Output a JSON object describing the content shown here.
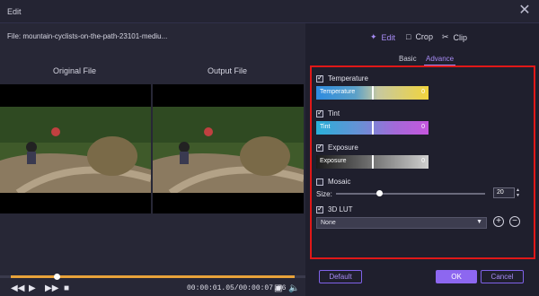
{
  "window": {
    "title": "Edit",
    "close_symbol": "✕"
  },
  "left": {
    "file_label": "File:  mountain-cyclists-on-the-path-23101-mediu...",
    "original_label": "Original File",
    "output_label": "Output File",
    "playback": {
      "progress_fraction": 0.15,
      "time": "00:00:01.05/00:00:07.06"
    }
  },
  "top_tabs": {
    "edit": "Edit",
    "crop": "Crop",
    "clip": "Clip"
  },
  "sub_tabs": {
    "basic": "Basic",
    "advance": "Advance"
  },
  "adjustments": {
    "temperature": {
      "label": "Temperature",
      "slider_label": "Temperature",
      "value": "0",
      "checked": true
    },
    "tint": {
      "label": "Tint",
      "slider_label": "Tint",
      "value": "0",
      "checked": true
    },
    "exposure": {
      "label": "Exposure",
      "slider_label": "Exposure",
      "value": "0",
      "checked": true
    },
    "mosaic": {
      "label": "Mosaic",
      "checked": false,
      "size_label": "Size:",
      "size_value": "20"
    },
    "lut": {
      "label": "3D LUT",
      "checked": true,
      "selected": "None"
    }
  },
  "buttons": {
    "default": "Default",
    "ok": "OK",
    "cancel": "Cancel"
  },
  "colors": {
    "accent": "#8d67f0",
    "highlight_border": "#e01818"
  }
}
